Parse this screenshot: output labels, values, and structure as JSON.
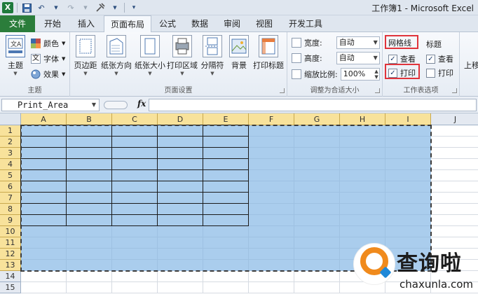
{
  "window": {
    "title": "工作簿1 - Microsoft Excel"
  },
  "quick_access": {
    "icons": [
      "excel-logo",
      "save-icon",
      "undo-icon",
      "redo-icon",
      "customize-icon"
    ],
    "logo_letter": "X",
    "redo_glyph": "↷",
    "undo_glyph": "↶"
  },
  "tabs": [
    {
      "label": "文件"
    },
    {
      "label": "开始"
    },
    {
      "label": "插入"
    },
    {
      "label": "页面布局",
      "active": true
    },
    {
      "label": "公式"
    },
    {
      "label": "数据"
    },
    {
      "label": "审阅"
    },
    {
      "label": "视图"
    },
    {
      "label": "开发工具"
    }
  ],
  "ribbon": {
    "theme": {
      "label": "主题",
      "buttons": {
        "themes": "主题",
        "colors": "颜色",
        "fonts": "字体",
        "effects": "效果"
      },
      "font_glyph": "文"
    },
    "page_setup": {
      "label": "页面设置",
      "buttons": [
        "页边距",
        "纸张方向",
        "纸张大小",
        "打印区域",
        "分隔符",
        "背景",
        "打印标题"
      ]
    },
    "scale_to_fit": {
      "label": "调整为合适大小",
      "width_label": "宽度:",
      "width_value": "自动",
      "height_label": "高度:",
      "height_value": "自动",
      "scale_label": "缩放比例:",
      "scale_value": "100%"
    },
    "sheet_options": {
      "label": "工作表选项",
      "gridlines": {
        "title": "网格线",
        "view_label": "查看",
        "view_checked": true,
        "print_label": "打印",
        "print_checked": true
      },
      "headings": {
        "title": "标题",
        "view_label": "查看",
        "view_checked": true,
        "print_label": "打印",
        "print_checked": false
      }
    },
    "arrange_partial_label": "上移"
  },
  "formula_bar": {
    "name_box": "Print_Area",
    "fx_label": "fx",
    "formula": ""
  },
  "sheet": {
    "columns": [
      "A",
      "B",
      "C",
      "D",
      "E",
      "F",
      "G",
      "H",
      "I",
      "J"
    ],
    "rows": [
      "1",
      "2",
      "3",
      "4",
      "5",
      "6",
      "7",
      "8",
      "9",
      "10",
      "11",
      "12",
      "13",
      "14",
      "15"
    ],
    "selection": "A1:I13",
    "bordered_table": "A1:E9",
    "highlight_color": "#aacded",
    "header_highlight_color": "#f8e29b"
  },
  "watermark": {
    "text_cn": "查询啦",
    "text_en": "chaxunla.com"
  },
  "annotations": {
    "highlight_color": "#e0343b",
    "targets": [
      "gridlines-title",
      "gridlines-print-checkbox"
    ]
  }
}
